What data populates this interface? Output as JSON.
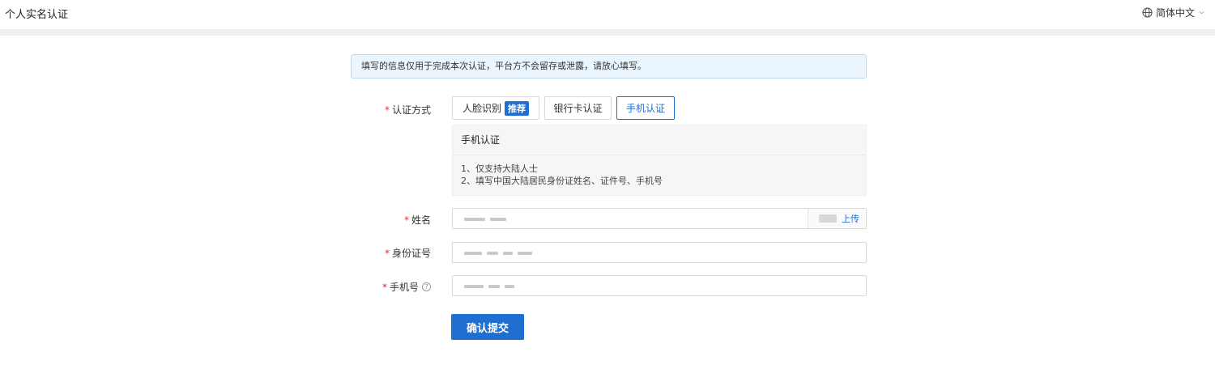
{
  "header": {
    "title": "个人实名认证",
    "language": "简体中文",
    "language_icon": "globe-icon",
    "dropdown_icon": "chevron-down-icon"
  },
  "notice": "填写的信息仅用于完成本次认证，平台方不会留存或泄露，请放心填写。",
  "method": {
    "label": "认证方式",
    "options": [
      {
        "label": "人脸识别",
        "badge": "推荐"
      },
      {
        "label": "银行卡认证"
      },
      {
        "label": "手机认证",
        "selected": true
      }
    ]
  },
  "info": {
    "title": "手机认证",
    "lines": [
      "1、仅支持大陆人士",
      "2、填写中国大陆居民身份证姓名、证件号、手机号"
    ]
  },
  "fields": {
    "name": {
      "label": "姓名",
      "upload_label": "上传"
    },
    "id_number": {
      "label": "身份证号"
    },
    "phone": {
      "label": "手机号",
      "help": "?"
    }
  },
  "required_mark": "*",
  "submit_label": "确认提交",
  "colors": {
    "primary": "#1f6fd0",
    "required": "#f5222d",
    "notice_bg": "#eaf5fd"
  }
}
